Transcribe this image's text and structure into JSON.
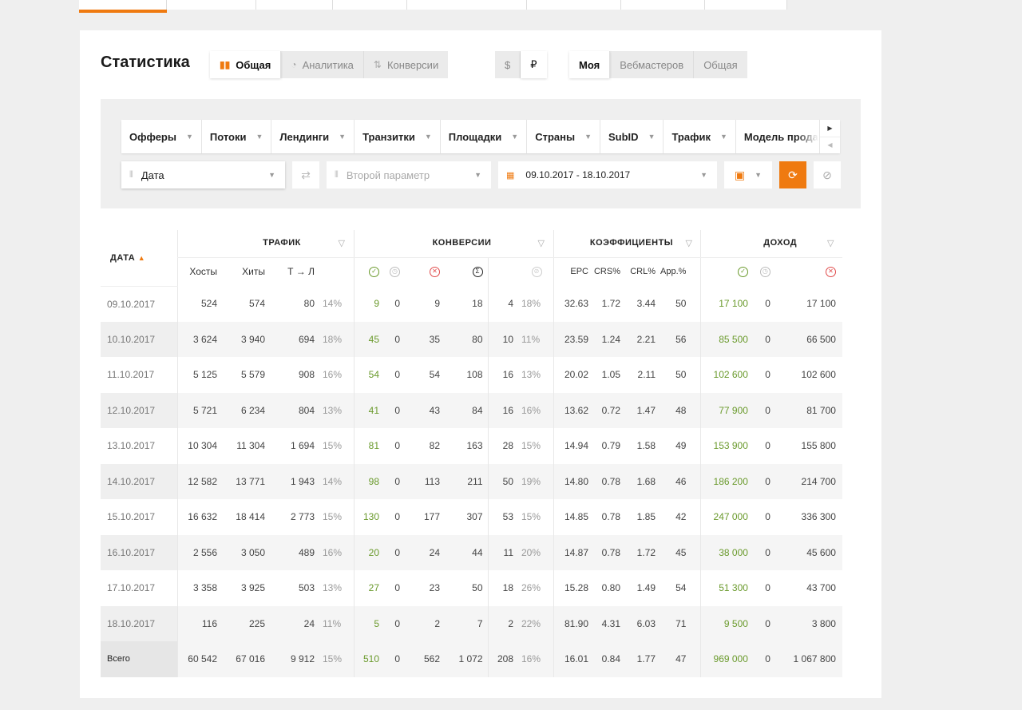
{
  "title": "Статистика",
  "view_tabs": [
    {
      "label": "Общая",
      "icon": "bar-chart-icon",
      "active": true
    },
    {
      "label": "Аналитика",
      "icon": "pie-chart-icon",
      "active": false
    },
    {
      "label": "Конверсии",
      "icon": "sort-arrows-icon",
      "active": false
    }
  ],
  "currency_tabs": [
    {
      "label": "$",
      "active": false
    },
    {
      "label": "₽",
      "active": true
    }
  ],
  "scope_tabs": [
    {
      "label": "Моя",
      "active": true
    },
    {
      "label": "Вебмастеров",
      "active": false
    },
    {
      "label": "Общая",
      "active": false
    }
  ],
  "filter_bar": [
    "Офферы",
    "Потоки",
    "Лендинги",
    "Транзитки",
    "Площадки",
    "Страны",
    "SubID",
    "Трафик",
    "Модель прода"
  ],
  "param1": {
    "value": "Дата"
  },
  "param2": {
    "placeholder": "Второй параметр"
  },
  "date_range": "09.10.2017 - 18.10.2017",
  "table": {
    "date_header": "ДАТА",
    "groups": {
      "traffic": "ТРАФИК",
      "conversions": "КОНВЕРСИИ",
      "ratios": "КОЭФФИЦИЕНТЫ",
      "income": "ДОХОД"
    },
    "sub": {
      "hosts": "Хосты",
      "hits": "Хиты",
      "tl": "Т → Л",
      "epc": "EPC",
      "crs": "CRS%",
      "crl": "CRL%",
      "app": "App.%"
    },
    "rows": [
      [
        "09.10.2017",
        "524",
        "574",
        "80",
        "14%",
        "9",
        "0",
        "9",
        "18",
        "4",
        "18%",
        "32.63",
        "1.72",
        "3.44",
        "50",
        "17 100",
        "0",
        "17 100"
      ],
      [
        "10.10.2017",
        "3 624",
        "3 940",
        "694",
        "18%",
        "45",
        "0",
        "35",
        "80",
        "10",
        "11%",
        "23.59",
        "1.24",
        "2.21",
        "56",
        "85 500",
        "0",
        "66 500"
      ],
      [
        "11.10.2017",
        "5 125",
        "5 579",
        "908",
        "16%",
        "54",
        "0",
        "54",
        "108",
        "16",
        "13%",
        "20.02",
        "1.05",
        "2.11",
        "50",
        "102 600",
        "0",
        "102 600"
      ],
      [
        "12.10.2017",
        "5 721",
        "6 234",
        "804",
        "13%",
        "41",
        "0",
        "43",
        "84",
        "16",
        "16%",
        "13.62",
        "0.72",
        "1.47",
        "48",
        "77 900",
        "0",
        "81 700"
      ],
      [
        "13.10.2017",
        "10 304",
        "11 304",
        "1 694",
        "15%",
        "81",
        "0",
        "82",
        "163",
        "28",
        "15%",
        "14.94",
        "0.79",
        "1.58",
        "49",
        "153 900",
        "0",
        "155 800"
      ],
      [
        "14.10.2017",
        "12 582",
        "13 771",
        "1 943",
        "14%",
        "98",
        "0",
        "113",
        "211",
        "50",
        "19%",
        "14.80",
        "0.78",
        "1.68",
        "46",
        "186 200",
        "0",
        "214 700"
      ],
      [
        "15.10.2017",
        "16 632",
        "18 414",
        "2 773",
        "15%",
        "130",
        "0",
        "177",
        "307",
        "53",
        "15%",
        "14.85",
        "0.78",
        "1.85",
        "42",
        "247 000",
        "0",
        "336 300"
      ],
      [
        "16.10.2017",
        "2 556",
        "3 050",
        "489",
        "16%",
        "20",
        "0",
        "24",
        "44",
        "11",
        "20%",
        "14.87",
        "0.78",
        "1.72",
        "45",
        "38 000",
        "0",
        "45 600"
      ],
      [
        "17.10.2017",
        "3 358",
        "3 925",
        "503",
        "13%",
        "27",
        "0",
        "23",
        "50",
        "18",
        "26%",
        "15.28",
        "0.80",
        "1.49",
        "54",
        "51 300",
        "0",
        "43 700"
      ],
      [
        "18.10.2017",
        "116",
        "225",
        "24",
        "11%",
        "5",
        "0",
        "2",
        "7",
        "2",
        "22%",
        "81.90",
        "4.31",
        "6.03",
        "71",
        "9 500",
        "0",
        "3 800"
      ]
    ],
    "total": [
      "Всего",
      "60 542",
      "67 016",
      "9 912",
      "15%",
      "510",
      "0",
      "562",
      "1 072",
      "208",
      "16%",
      "16.01",
      "0.84",
      "1.77",
      "47",
      "969 000",
      "0",
      "1 067 800"
    ]
  },
  "colors": {
    "accent": "#ef7a10",
    "green": "#6a9a2c",
    "red": "#e04a4a"
  }
}
